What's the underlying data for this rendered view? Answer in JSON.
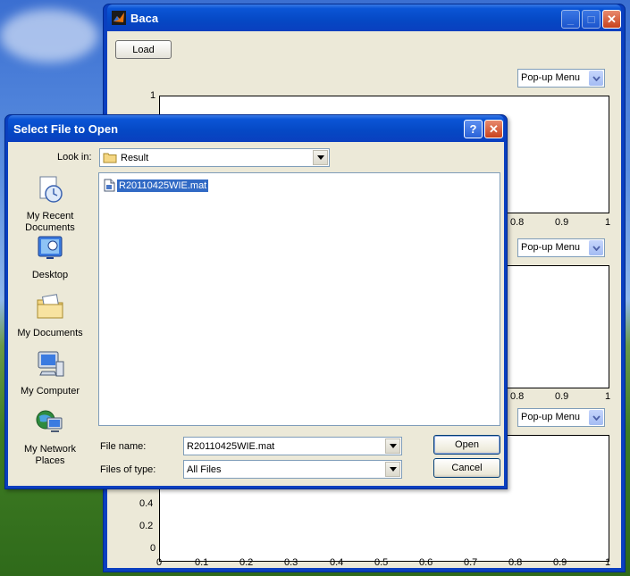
{
  "figure": {
    "title": "Baca",
    "load_label": "Load",
    "popups": [
      "Pop-up Menu",
      "Pop-up Menu",
      "Pop-up Menu"
    ],
    "axes1": {
      "y_top": "1",
      "x_ticks": [
        "0.8",
        "0.9",
        "1"
      ]
    },
    "axes2": {
      "x_ticks": [
        "0.8",
        "0.9",
        "1"
      ]
    },
    "axes3": {
      "y_ticks": [
        "0.4",
        "0.2",
        "0"
      ],
      "x_ticks": [
        "0",
        "0.1",
        "0.2",
        "0.3",
        "0.4",
        "0.5",
        "0.6",
        "0.7",
        "0.8",
        "0.9",
        "1"
      ]
    }
  },
  "dialog": {
    "title": "Select File to Open",
    "look_in_label": "Look in:",
    "look_in_value": "Result",
    "places": [
      "My Recent\nDocuments",
      "Desktop",
      "My Documents",
      "My Computer",
      "My Network\nPlaces"
    ],
    "files": [
      "R20110425WIE.mat"
    ],
    "file_name_label": "File name:",
    "file_name_value": "R20110425WIE.mat",
    "file_type_label": "Files of type:",
    "file_type_value": "All Files",
    "open_label": "Open",
    "cancel_label": "Cancel"
  }
}
